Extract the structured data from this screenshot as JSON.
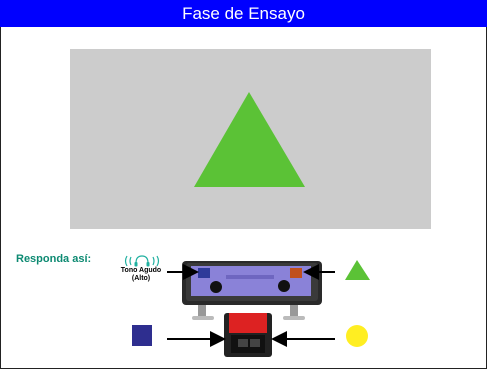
{
  "window": {
    "title": "Fase de Ensayo"
  },
  "stimulus": {
    "shape": "triangle",
    "color": "#5bc236",
    "background": "#cccccc"
  },
  "instructions": {
    "label": "Responda así:",
    "tone_line1": "Tono Agudo",
    "tone_line2": "(Alto)"
  },
  "colors": {
    "title_bar": "#0000ff",
    "label_teal": "#0d8a72",
    "square": "#2e2e8f",
    "triangle": "#5bc236",
    "circle": "#ffee22",
    "pedal": "#dd2222"
  },
  "icons": [
    "headphones-icon",
    "gamepad-icon",
    "foot-pedal-icon",
    "arrow-icon"
  ]
}
